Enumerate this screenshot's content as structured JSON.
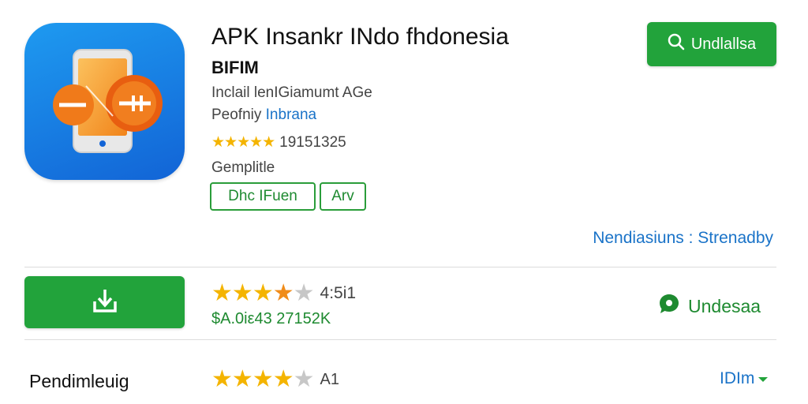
{
  "app": {
    "title": "APK Insankr INdo fhdonesia",
    "subtitle": "BIFIM",
    "meta": "Inclail lenIGiamumt AGe",
    "developer_label": "Peofniy",
    "developer_name": "Inbrana",
    "stars": "★★★★★",
    "rating_count": "19151325",
    "category": "Gemplitle",
    "tags": [
      "Dhc IFuen",
      "Arv"
    ]
  },
  "header": {
    "button_label": "Undlallsa"
  },
  "links": {
    "text": "Nendiasiuns : Strenadby"
  },
  "row_rating": {
    "score": "4:5i1",
    "size_text": "$A.0iε43 27152K",
    "value": 3.5
  },
  "share": {
    "label": "Undesaa"
  },
  "row_review": {
    "label": "Pendimleuig",
    "score": "A1",
    "dropdown_label": "IDIm"
  },
  "colors": {
    "brand_green": "#22a33b",
    "link_blue": "#1a73c8",
    "star_gold": "#f4b400"
  },
  "icons": [
    "search-icon",
    "download-icon",
    "chat-icon",
    "chevron-down-icon"
  ]
}
